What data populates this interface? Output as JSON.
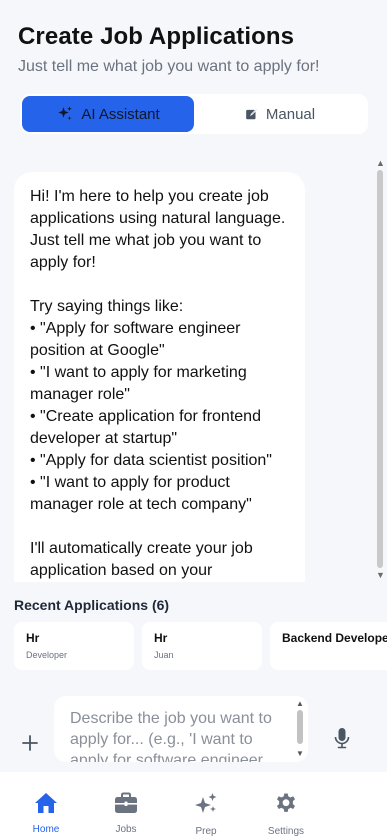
{
  "header": {
    "title": "Create Job Applications",
    "subtitle": "Just tell me what job you want to apply for!"
  },
  "mode_toggle": {
    "ai_label": "AI Assistant",
    "manual_label": "Manual",
    "active": "ai"
  },
  "chat": {
    "assistant_message": "Hi! I'm here to help you create job applications using natural language. Just tell me what job you want to apply for!\n\nTry saying things like:\n• \"Apply for software engineer position at Google\"\n• \"I want to apply for marketing manager role\"\n• \"Create application for frontend developer at startup\"\n• \"Apply for data scientist position\"\n• \"I want to apply for product manager role at tech company\"\n\nI'll automatically create your job application based on your"
  },
  "recent": {
    "label": "Recent Applications",
    "count_text": "(6)",
    "items": [
      {
        "title": "Hr",
        "subtitle": "Developer"
      },
      {
        "title": "Hr",
        "subtitle": "Juan"
      },
      {
        "title": "Backend Developer",
        "subtitle": ""
      }
    ]
  },
  "composer": {
    "placeholder": "Describe the job you want to apply for... (e.g., 'I want to apply for software engineer"
  },
  "bottom_nav": {
    "items": [
      {
        "label": "Home",
        "icon": "home-icon",
        "active": true
      },
      {
        "label": "Jobs",
        "icon": "briefcase-icon",
        "active": false
      },
      {
        "label": "Prep",
        "icon": "sparkles-icon",
        "active": false
      },
      {
        "label": "Settings",
        "icon": "gear-icon",
        "active": false
      }
    ]
  },
  "colors": {
    "accent": "#2563eb",
    "background": "#f6f7fa",
    "surface": "#ffffff",
    "muted_text": "#6b7280"
  }
}
